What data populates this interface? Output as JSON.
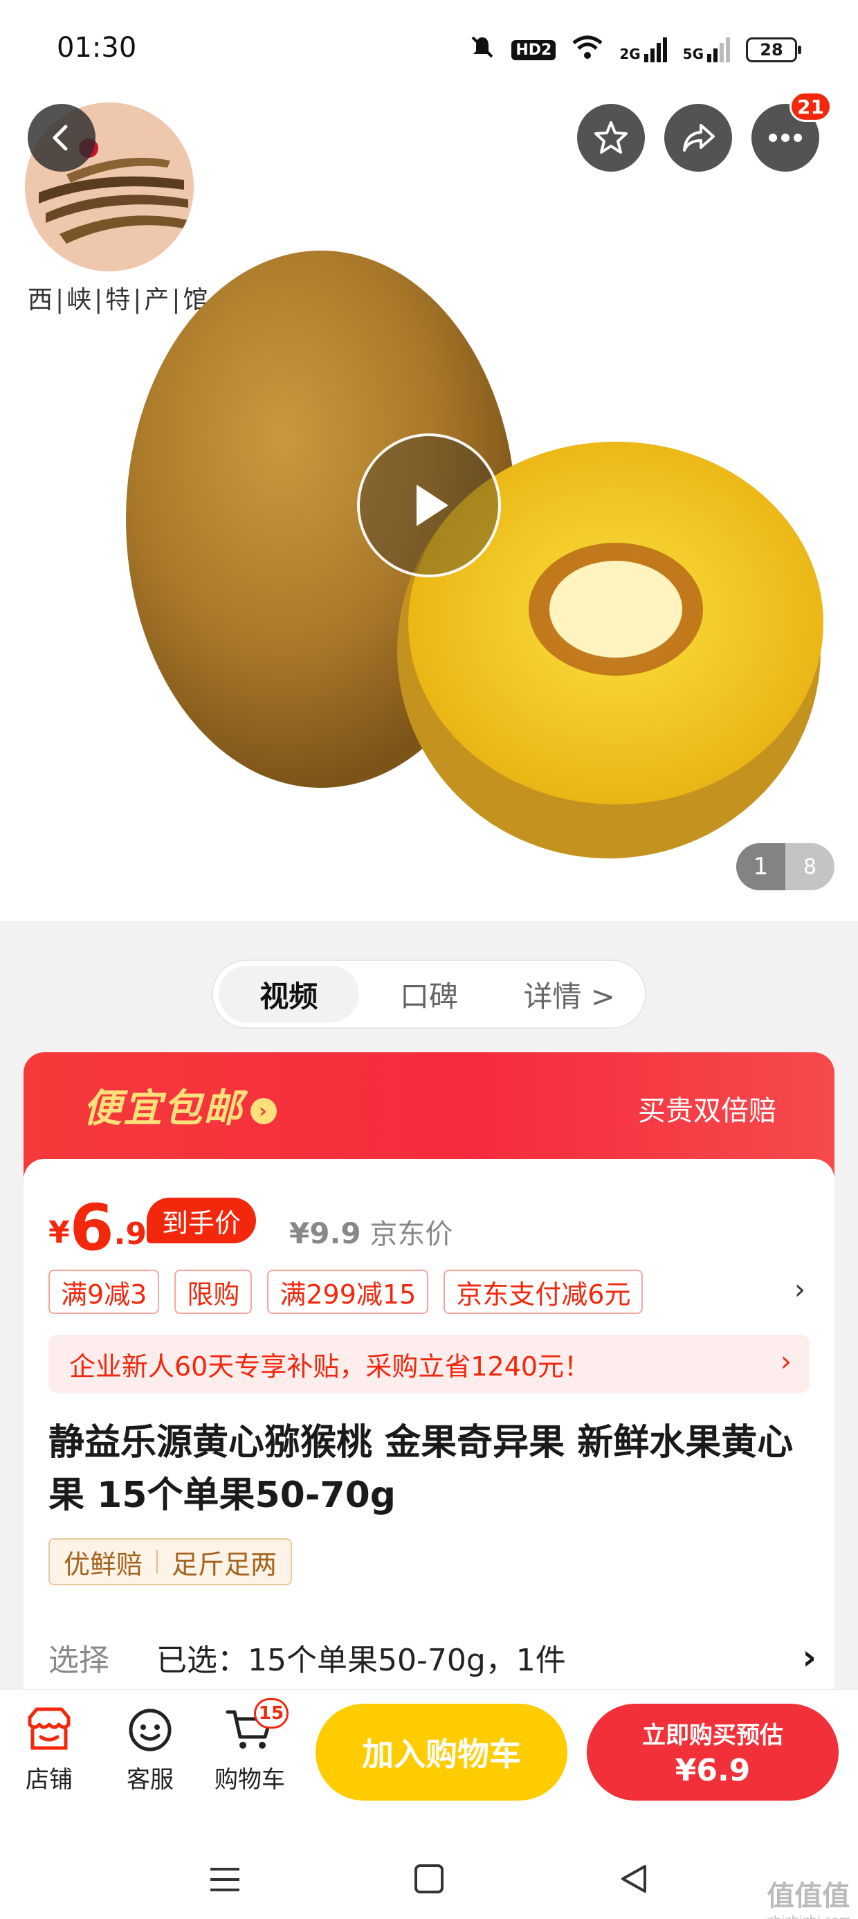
{
  "status_bar": {
    "time": "01:30",
    "hd": "HD2",
    "net1": "2G",
    "net2": "5G",
    "battery": "28"
  },
  "top_buttons": {
    "more_badge": "21"
  },
  "hero": {
    "shop_logo_text": "西|峡|特|产|馆",
    "pager_current": "1",
    "pager_total": "8"
  },
  "media_tabs": [
    {
      "label": "视频"
    },
    {
      "label": "口碑"
    },
    {
      "label": "详情 >"
    }
  ],
  "promo": {
    "title": "便宜包邮",
    "right_text": "买贵双倍赔"
  },
  "price": {
    "yen": "¥",
    "integer": "6",
    "decimal": ".9",
    "final_tag": "到手价",
    "original": "¥9.9",
    "original_label": "京东价"
  },
  "coupon_tags": [
    "满9减3",
    "限购",
    "满299减15",
    "京东支付减6元"
  ],
  "subsidy_text": "企业新人60天专享补贴，采购立省1240元！",
  "product_title": "静益乐源黄心猕猴桃 金果奇异果 新鲜水果黄心果 15个单果50-70g",
  "features": [
    "优鲜赔",
    "足斤足两"
  ],
  "selection": {
    "label": "选择",
    "value": "已选：15个单果50-70g，1件"
  },
  "action_bar": {
    "shop": "店铺",
    "service": "客服",
    "cart": "购物车",
    "cart_badge": "15",
    "add_to_cart": "加入购物车",
    "buy_line1": "立即购买预估",
    "buy_line2": "¥6.9"
  },
  "watermark": {
    "main": "值值值",
    "sub": "zhizhizhi.com"
  },
  "colors": {
    "accent_red": "#f2270c",
    "cart_yellow": "#ffcc00",
    "promo_yellow": "#ffe07a"
  }
}
